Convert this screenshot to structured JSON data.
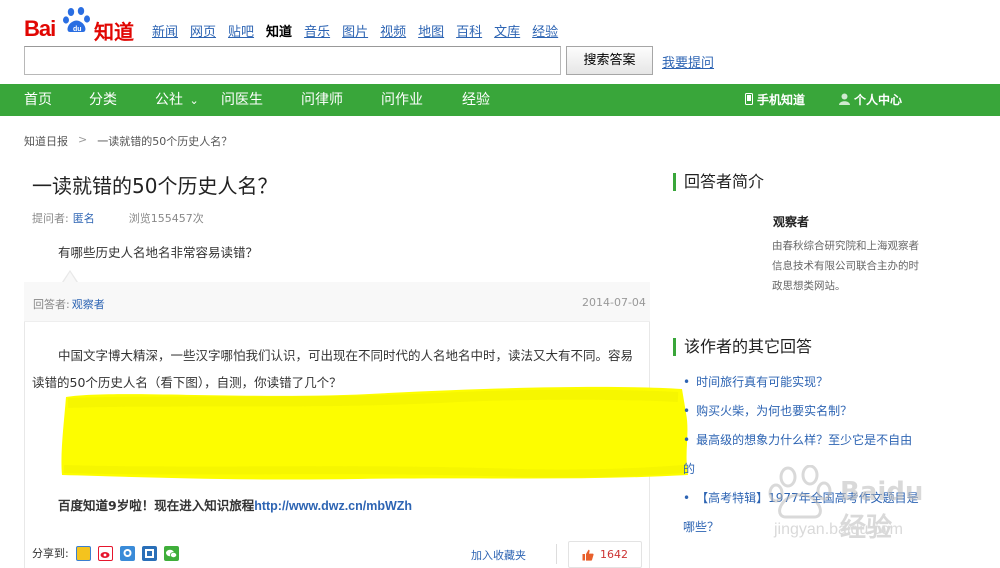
{
  "header": {
    "logo_bai": "Bai",
    "logo_zhidao": "知道",
    "nav": [
      "新闻",
      "网页",
      "贴吧",
      "知道",
      "音乐",
      "图片",
      "视频",
      "地图",
      "百科",
      "文库",
      "经验"
    ],
    "search_button": "搜索答案",
    "ask_link": "我要提问"
  },
  "green_nav": {
    "items": [
      "首页",
      "分类",
      "公社",
      "问医生",
      "问律师",
      "问作业",
      "经验"
    ],
    "chevron": "⌄",
    "mobile": "手机知道",
    "user_center": "个人中心"
  },
  "breadcrumb": {
    "root": "知道日报",
    "sep": ">",
    "current": "一读就错的50个历史人名？"
  },
  "question": {
    "title": "一读就错的50个历史人名？",
    "asker_label": "提问者:",
    "asker": "匿名",
    "views": "浏览155457次",
    "body": "有哪些历史人名地名非常容易读错？"
  },
  "answer": {
    "answerer_label": "回答者:",
    "answerer": "观察者",
    "date": "2014-07-04",
    "text": "中国文字博大精深，一些汉字哪怕我们认识，可出现在不同时代的人名地名中时，读法又大有不同。容易读错的50个历史人名（看下图），自测，你读错了几个？",
    "promo": "百度知道9岁啦！现在进入知识旅程",
    "promo_url": "http://www.dwz.cn/mbWZh",
    "highlight_color": "#fdfd00"
  },
  "footer_actions": {
    "share_label": "分享到:",
    "share_icons": [
      "qzone-icon",
      "weibo-icon",
      "qq-icon",
      "renren-icon",
      "wechat-icon"
    ],
    "favorite": "加入收藏夹",
    "likes": "1642"
  },
  "sidebar": {
    "intro_title": "回答者简介",
    "intro_name": "观察者",
    "intro_desc": "由春秋综合研究院和上海观察者信息技术有限公司联合主办的时政思想类网站。",
    "other_title": "该作者的其它回答",
    "other_answers": [
      "时间旅行真有可能实现？",
      "购买火柴，为何也要实名制？",
      "最高级的想象力什么样？至少它是不自由的",
      "【高考特辑】1977年全国高考作文题目是哪些？"
    ]
  },
  "watermark": {
    "text": "Baidu经验",
    "url": "jingyan.baidu.com"
  },
  "colors": {
    "brand_red": "#e10602",
    "nav_green": "#39a63a",
    "link_blue": "#2d64b3"
  }
}
